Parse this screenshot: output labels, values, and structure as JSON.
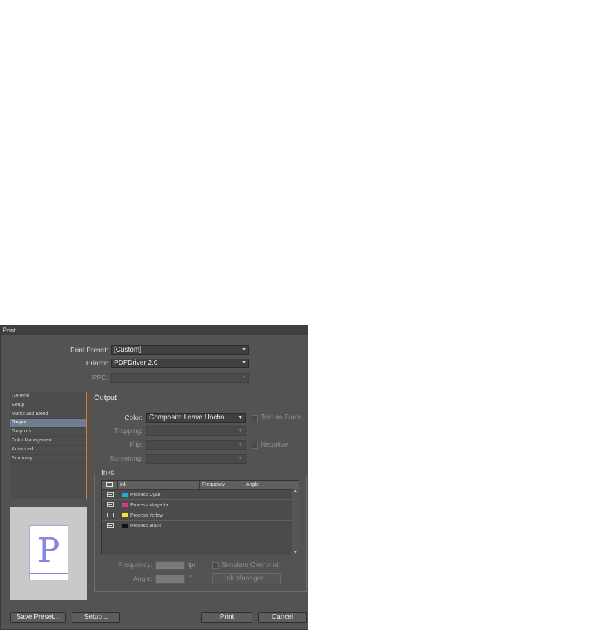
{
  "window": {
    "title": "Print"
  },
  "preset": {
    "label": "Print Preset:",
    "value": "[Custom]"
  },
  "printer": {
    "label": "Printer:",
    "value": "PDFDriver 2.0"
  },
  "ppd": {
    "label": "PPD:",
    "value": ""
  },
  "sidebar": {
    "items": [
      {
        "label": "General"
      },
      {
        "label": "Setup"
      },
      {
        "label": "Marks and Bleed"
      },
      {
        "label": "Output"
      },
      {
        "label": "Graphics"
      },
      {
        "label": "Color Management"
      },
      {
        "label": "Advanced"
      },
      {
        "label": "Summary"
      }
    ],
    "active": "Output"
  },
  "preview": {
    "glyph": "P"
  },
  "output": {
    "title": "Output",
    "color_label": "Color:",
    "color_value": "Composite Leave Uncha...",
    "text_as_black": "Text as Black",
    "trapping_label": "Trapping:",
    "flip_label": "Flip:",
    "negative": "Negative",
    "screening_label": "Screening:"
  },
  "inks": {
    "title": "Inks",
    "columns": {
      "ink": "Ink",
      "frequency": "Frequency",
      "angle": "Angle"
    },
    "rows": [
      {
        "name": "Process Cyan",
        "color": "#29a9d9"
      },
      {
        "name": "Process Magenta",
        "color": "#d9368f"
      },
      {
        "name": "Process Yellow",
        "color": "#f2e62c"
      },
      {
        "name": "Process Black",
        "color": "#111111"
      }
    ],
    "frequency_label": "Frequency:",
    "frequency_unit": "lpi",
    "angle_label": "Angle:",
    "angle_unit": "°",
    "simulate_overprint": "Simulate Overprint",
    "ink_manager": "Ink Manager..."
  },
  "buttons": {
    "save_preset": "Save Preset...",
    "setup": "Setup...",
    "print": "Print",
    "cancel": "Cancel"
  }
}
